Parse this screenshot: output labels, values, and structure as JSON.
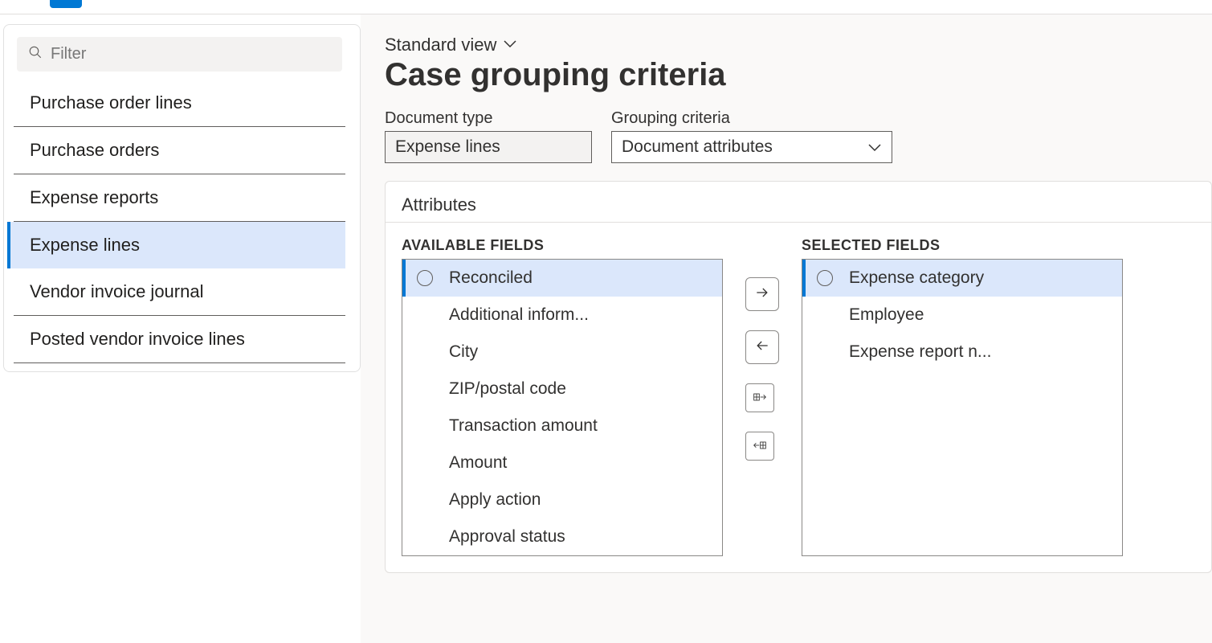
{
  "sidebar": {
    "filter_placeholder": "Filter",
    "items": [
      {
        "label": "Purchase order lines"
      },
      {
        "label": "Purchase orders"
      },
      {
        "label": "Expense reports"
      },
      {
        "label": "Expense lines"
      },
      {
        "label": "Vendor invoice journal"
      },
      {
        "label": "Posted vendor invoice lines"
      }
    ],
    "selected_index": 3
  },
  "main": {
    "view_label": "Standard view",
    "page_title": "Case grouping criteria",
    "document_type_label": "Document type",
    "document_type_value": "Expense lines",
    "grouping_criteria_label": "Grouping criteria",
    "grouping_criteria_value": "Document attributes",
    "attributes_title": "Attributes",
    "available_label": "AVAILABLE FIELDS",
    "selected_label": "SELECTED FIELDS",
    "available_fields": [
      "Reconciled",
      "Additional inform...",
      "City",
      "ZIP/postal code",
      "Transaction amount",
      "Amount",
      "Apply action",
      "Approval status"
    ],
    "available_selected_index": 0,
    "selected_fields": [
      "Expense category",
      "Employee",
      "Expense report n..."
    ],
    "selected_selected_index": 0
  }
}
